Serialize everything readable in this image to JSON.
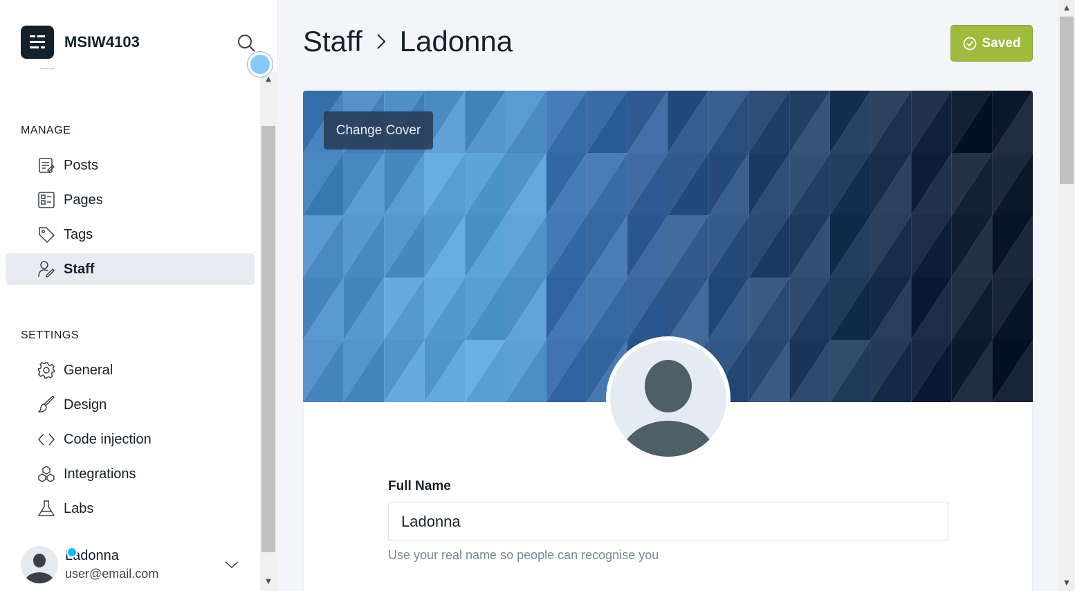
{
  "sidebar": {
    "brand_name": "MSIW4103",
    "manage_heading": "MANAGE",
    "settings_heading": "SETTINGS",
    "manage_items": [
      {
        "label": "Posts",
        "icon": "posts-icon"
      },
      {
        "label": "Pages",
        "icon": "pages-icon"
      },
      {
        "label": "Tags",
        "icon": "tag-icon"
      },
      {
        "label": "Staff",
        "icon": "staff-icon",
        "active": true
      }
    ],
    "settings_items": [
      {
        "label": "General",
        "icon": "gear-icon"
      },
      {
        "label": "Design",
        "icon": "brush-icon"
      },
      {
        "label": "Code injection",
        "icon": "code-icon"
      },
      {
        "label": "Integrations",
        "icon": "integrations-icon"
      },
      {
        "label": "Labs",
        "icon": "flask-icon"
      }
    ],
    "user": {
      "name": "Ladonna",
      "email": "user@email.com"
    }
  },
  "header": {
    "breadcrumb_parent": "Staff",
    "breadcrumb_current": "Ladonna",
    "saved_label": "Saved"
  },
  "cover": {
    "change_cover_label": "Change Cover"
  },
  "form": {
    "full_name_label": "Full Name",
    "full_name_value": "Ladonna",
    "full_name_help": "Use your real name so people can recognise you"
  },
  "colors": {
    "accent_green": "#9fbb3e",
    "active_nav_bg": "#e8ebf2",
    "notification_dot": "#14b8ff"
  }
}
